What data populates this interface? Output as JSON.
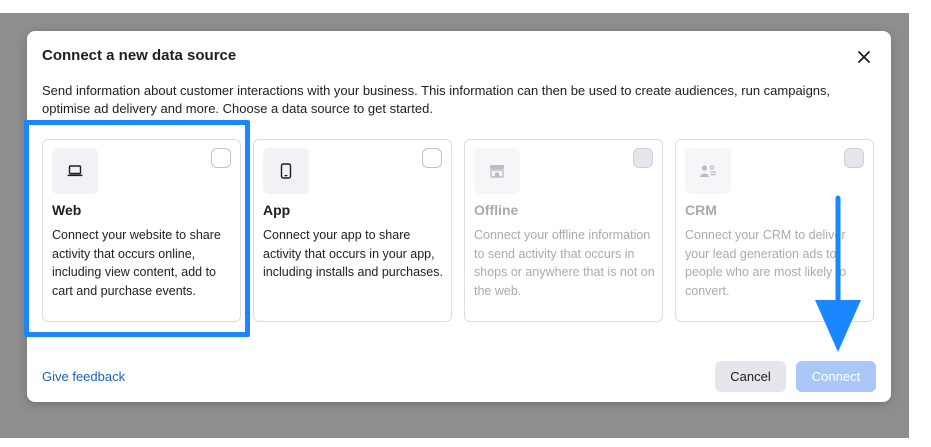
{
  "dialog": {
    "title": "Connect a new data source",
    "description": "Send information about customer interactions with your business. This information can then be used to create audiences, run campaigns, optimise ad delivery and more. Choose a data source to get started."
  },
  "sources": [
    {
      "icon": "laptop-icon",
      "title": "Web",
      "description": "Connect your website to share activity that occurs online, including view content, add to cart and purchase events.",
      "enabled": true
    },
    {
      "icon": "phone-icon",
      "title": "App",
      "description": "Connect your app to share activity that occurs in your app, including installs and purchases.",
      "enabled": true
    },
    {
      "icon": "store-icon",
      "title": "Offline",
      "description": "Connect your offline information to send activity that occurs in shops or anywhere that is not on the web.",
      "enabled": false
    },
    {
      "icon": "people-icon",
      "title": "CRM",
      "description": "Connect your CRM to deliver your lead generation ads to people who are most likely to convert.",
      "enabled": false
    }
  ],
  "footer": {
    "feedback_label": "Give feedback",
    "cancel_label": "Cancel",
    "connect_label": "Connect"
  },
  "annotations": {
    "highlight_color": "#1b87ff",
    "arrow_color": "#1b87ff"
  },
  "colors": {
    "link": "#1a62b4",
    "primary_disabled": "#a9c8f7",
    "secondary_button": "#e4e6eb"
  }
}
